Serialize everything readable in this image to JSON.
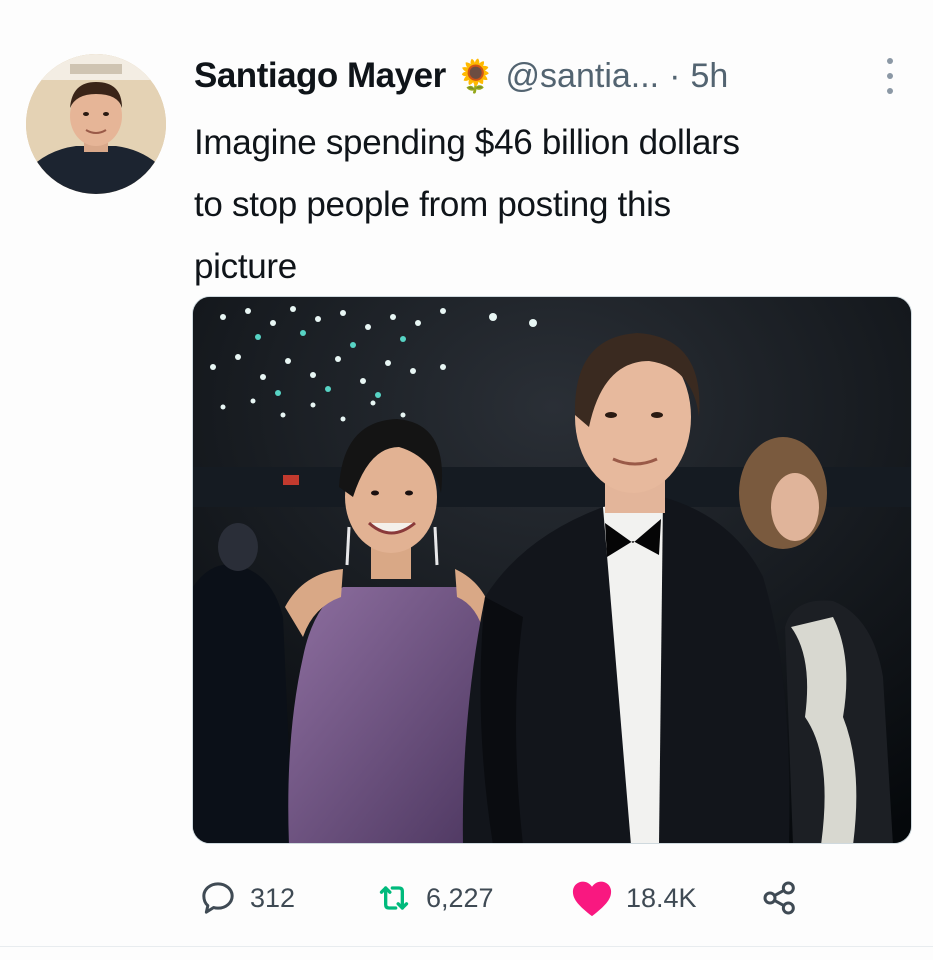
{
  "tweet": {
    "author_name": "Santiago Mayer",
    "author_emoji": "🌻",
    "handle": "@santia...",
    "separator": "·",
    "time": "5h",
    "text_lines": [
      "Imagine spending $46 billion dollars",
      "to stop people from posting this",
      "picture"
    ],
    "media": {
      "description_icon": "photo"
    }
  },
  "actions": {
    "replies": "312",
    "retweets": "6,227",
    "likes": "18.4K"
  },
  "colors": {
    "text": "#0f1419",
    "secondary": "#536471",
    "like": "#f91880",
    "retweet": "#00ba7c"
  }
}
